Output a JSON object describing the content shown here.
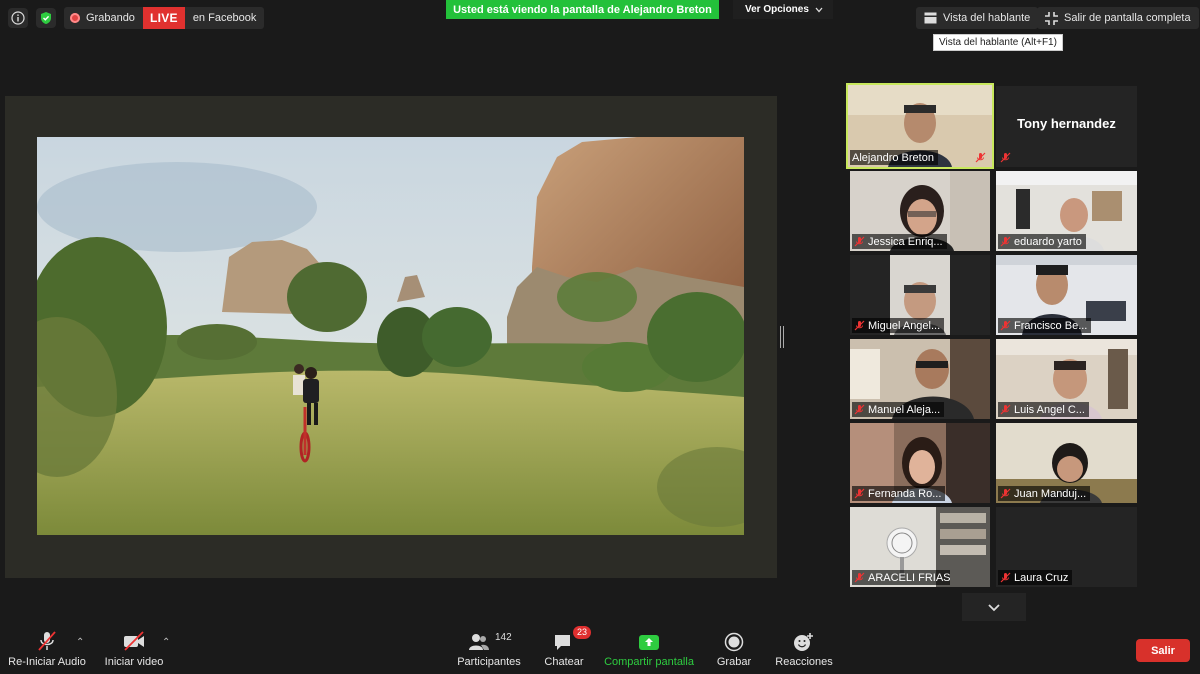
{
  "topbar": {
    "recording_label": "Grabando",
    "live_badge": "LIVE",
    "live_text": "en Facebook",
    "share_banner": "Usted está viendo la pantalla de Alejandro Breton",
    "view_options": "Ver Opciones",
    "speaker_view": "Vista del hablante",
    "exit_fullscreen": "Salir de pantalla completa",
    "tooltip": "Vista del hablante (Alt+F1)"
  },
  "participants": [
    {
      "name": "Alejandro Breton"
    },
    {
      "name": "Tony hernandez"
    },
    {
      "name": "Jessica Enriq..."
    },
    {
      "name": "eduardo yarto"
    },
    {
      "name": "Miguel Angel..."
    },
    {
      "name": "Francisco Be..."
    },
    {
      "name": "Manuel Aleja..."
    },
    {
      "name": "Luis Angel C..."
    },
    {
      "name": "Fernanda Ro..."
    },
    {
      "name": "Juan Manduj..."
    },
    {
      "name": "ARACELI FRIAS"
    },
    {
      "name": "Laura Cruz"
    }
  ],
  "toolbar": {
    "audio": "Re-Iniciar Audio",
    "video": "Iniciar video",
    "participants": "Participantes",
    "participants_count": "142",
    "chat": "Chatear",
    "chat_badge": "23",
    "share": "Compartir pantalla",
    "record": "Grabar",
    "reactions": "Reacciones",
    "leave": "Salir"
  },
  "colors": {
    "banner_green": "#23c13a",
    "live_red": "#e0312f",
    "active_speaker": "#c8e85c",
    "leave_red": "#d8312b"
  }
}
